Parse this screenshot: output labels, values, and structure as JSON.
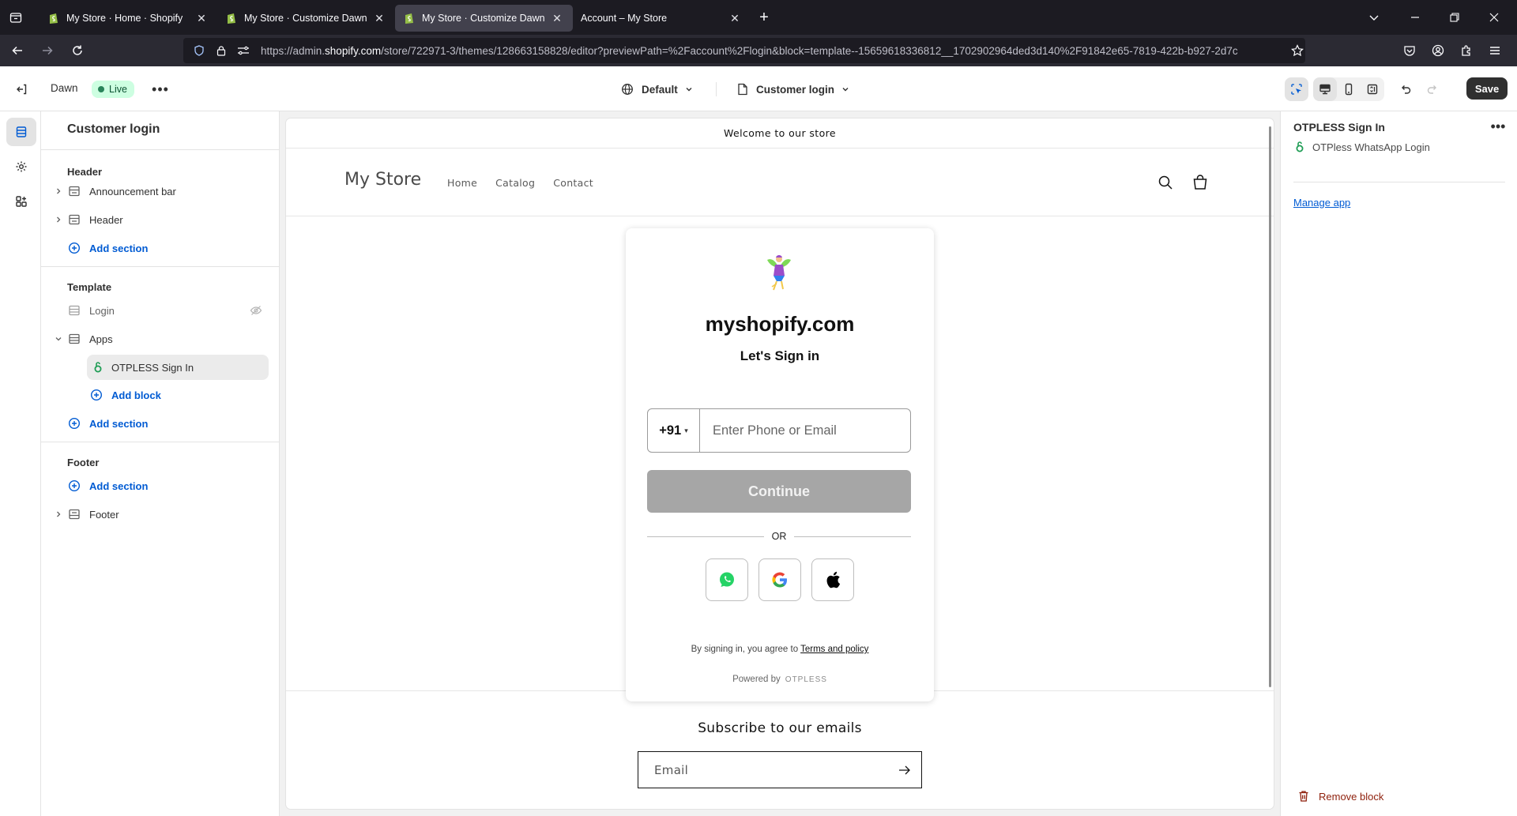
{
  "browser": {
    "tabs": [
      {
        "title": "My Store · Home · Shopify",
        "active": false
      },
      {
        "title": "My Store · Customize Dawn · Sh",
        "active": false
      },
      {
        "title": "My Store · Customize Dawn · Sh",
        "active": true
      },
      {
        "title": "Account – My Store",
        "active": false
      }
    ],
    "url_prefix": "https://admin.",
    "url_domain": "shopify.com",
    "url_rest": "/store/722971-3/themes/128663158828/editor?previewPath=%2Faccount%2Flogin&block=template--15659618336812__1702902964ded3d140%2F91842e65-7819-422b-b927-2d7c"
  },
  "topbar": {
    "theme_name": "Dawn",
    "live_badge": "Live",
    "more": "•••",
    "theme_selector": "Default",
    "page_selector": "Customer login",
    "save_label": "Save"
  },
  "sidebar": {
    "title": "Customer login",
    "header_group": {
      "title": "Header",
      "items": [
        "Announcement bar",
        "Header"
      ],
      "add_section": "Add section"
    },
    "template_group": {
      "title": "Template",
      "login": "Login",
      "apps": "Apps",
      "block": "OTPLESS Sign In",
      "add_block": "Add block",
      "add_section": "Add section"
    },
    "footer_group": {
      "title": "Footer",
      "add_section": "Add section",
      "footer": "Footer"
    }
  },
  "preview": {
    "announcement": "Welcome to our store",
    "store_logo": "My Store",
    "menu": [
      "Home",
      "Catalog",
      "Contact"
    ],
    "modal": {
      "domain": "myshopify.com",
      "subtitle": "Let's Sign in",
      "country_code": "+91",
      "phone_placeholder": "Enter Phone or Email",
      "continue_label": "Continue",
      "or_label": "OR",
      "terms_prefix": "By signing in, you agree to ",
      "terms_link": "Terms and policy",
      "powered_by": "Powered by",
      "brand": "OTPLESS"
    },
    "newsletter_title": "Subscribe to our emails",
    "email_placeholder": "Email"
  },
  "right_panel": {
    "title": "OTPLESS Sign In",
    "app_name": "OTPless WhatsApp Login",
    "manage_app": "Manage app",
    "remove_block": "Remove block"
  },
  "colors": {
    "accent_link": "#005bd3",
    "live_badge_bg": "#cdfee1",
    "save_bg": "#303030",
    "continue_bg": "#a6a6a6",
    "remove_text": "#8e1f0b"
  },
  "icons": [
    "tab-list-icon",
    "shopify-favicon-icon",
    "close-icon",
    "plus-icon",
    "minimize-icon",
    "restore-icon",
    "back-icon",
    "forward-icon",
    "reload-icon",
    "shield-icon",
    "lock-icon",
    "permissions-icon",
    "star-icon",
    "pocket-icon",
    "account-icon",
    "extensions-icon",
    "menu-icon",
    "exit-icon",
    "globe-icon",
    "page-icon",
    "chevron-down-icon",
    "inspector-icon",
    "desktop-icon",
    "mobile-icon",
    "fullscreen-icon",
    "undo-icon",
    "redo-icon",
    "sections-icon",
    "settings-icon",
    "apps-icon",
    "section-icon",
    "hidden-eye-icon",
    "add-circle-icon",
    "otpless-app-icon",
    "search-icon",
    "cart-icon",
    "fairy-logo-icon",
    "whatsapp-icon",
    "google-icon",
    "apple-icon",
    "arrow-right-icon",
    "trash-icon"
  ]
}
